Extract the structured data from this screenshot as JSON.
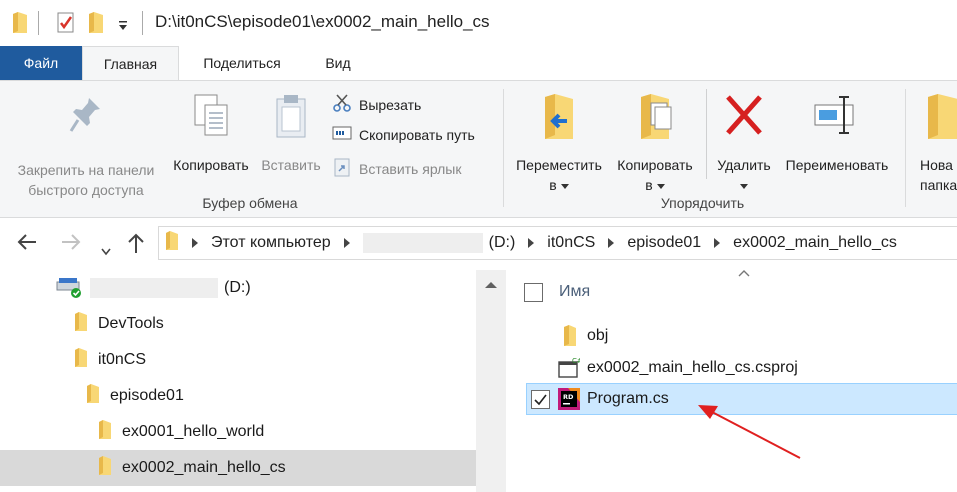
{
  "window": {
    "title": "D:\\it0nCS\\episode01\\ex0002_main_hello_cs"
  },
  "quick_access": {
    "icons": [
      "folder-icon",
      "properties-checkmark-icon",
      "new-folder-icon",
      "customize-dropdown-icon"
    ]
  },
  "ribbon_tabs": {
    "file": "Файл",
    "home": "Главная",
    "share": "Поделиться",
    "view": "Вид"
  },
  "ribbon": {
    "clipboard": {
      "pin_line1": "Закрепить на панели",
      "pin_line2": "быстрого доступа",
      "copy": "Копировать",
      "paste": "Вставить",
      "cut": "Вырезать",
      "copy_path": "Скопировать путь",
      "paste_shortcut": "Вставить ярлык",
      "group_label": "Буфер обмена"
    },
    "organize": {
      "move_line1": "Переместить",
      "move_line2": "в",
      "copy_to_line1": "Копировать",
      "copy_to_line2": "в",
      "delete": "Удалить",
      "rename": "Переименовать",
      "group_label": "Упорядочить"
    },
    "new": {
      "new_folder_line1": "Нова",
      "new_folder_line2": "папка"
    }
  },
  "address_bar": {
    "crumbs": [
      "Этот компьютер",
      "(D:)",
      "it0nCS",
      "episode01",
      "ex0002_main_hello_cs"
    ]
  },
  "nav_pane": {
    "drive_label": "(D:)",
    "items": [
      {
        "label": "DevTools"
      },
      {
        "label": "it0nCS"
      },
      {
        "label": "episode01"
      },
      {
        "label": "ex0001_hello_world"
      },
      {
        "label": "ex0002_main_hello_cs",
        "selected": true
      }
    ]
  },
  "file_list": {
    "column_name": "Имя",
    "files": [
      {
        "name": "obj",
        "type": "folder"
      },
      {
        "name": "ex0002_main_hello_cs.csproj",
        "type": "csproj"
      },
      {
        "name": "Program.cs",
        "type": "rider-cs",
        "selected": true
      }
    ]
  },
  "colors": {
    "file_tab": "#1f5b9e",
    "selection": "#cce8ff",
    "selection_border": "#99d1ff",
    "nav_selected": "#d9d9d9",
    "folder": "#f8d775",
    "annotation_arrow": "#e02020"
  }
}
